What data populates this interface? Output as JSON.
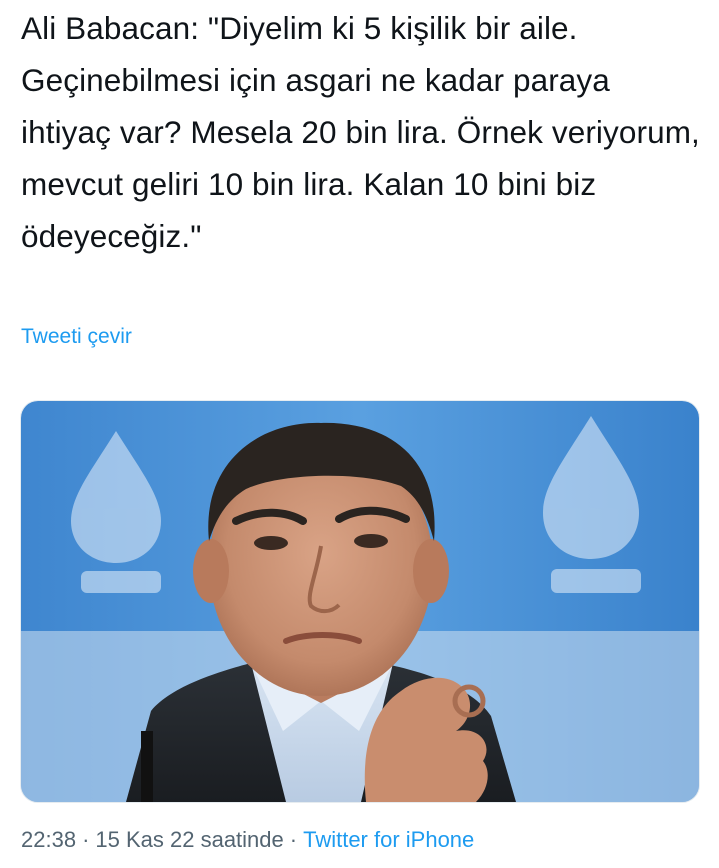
{
  "tweet": {
    "text": "Ali Babacan: \"Diyelim ki 5 kişilik bir aile. Geçinebilmesi için asgari ne kadar paraya ihtiyaç var? Mesela 20 bin lira. Örnek veriyorum, mevcut geliri 10 bin lira. Kalan 10 bini biz ödeyeceğiz.\"",
    "translate_label": "Tweeti çevir"
  },
  "meta": {
    "time": "22:38",
    "separator": "·",
    "date": "15 Kas 22 saatinde",
    "source": "Twitter for iPhone"
  },
  "colors": {
    "link": "#1d9bf0",
    "meta_text": "#536471",
    "body_text": "#0f1419",
    "photo_background": "#4a90d4"
  },
  "media": {
    "type": "photo"
  }
}
